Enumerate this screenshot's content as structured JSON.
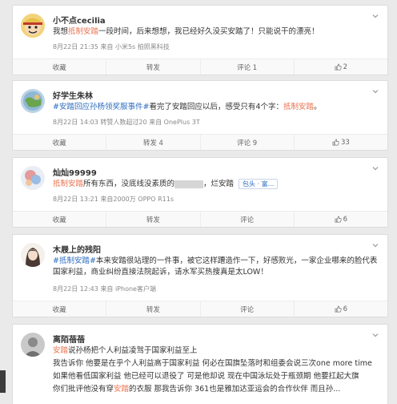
{
  "posts": [
    {
      "user": "小不点cecilia",
      "text_before": "我想",
      "tag": "抵制安踏",
      "text_after": "一段时间，后来想想，我已经好久没买安踏了！只能说干的漂亮！",
      "meta": "8月22日 21:35 来自 小米5s 拍照黑科技",
      "actions": {
        "collect": "收藏",
        "repost": "转发",
        "comment": "评论 1",
        "like": "2"
      }
    },
    {
      "user": "好学生朱林",
      "topic": "#安踏回应孙杨领奖服事件#",
      "text_mid": "看完了安踏回应以后，感受只有4个字：",
      "tag": "抵制安踏",
      "text_end": "。",
      "meta": "8月22日 14:03 转赞人数超过20 来自 OnePlus 3T",
      "actions": {
        "collect": "收藏",
        "repost": "转发 4",
        "comment": "评论 9",
        "like": "33"
      }
    },
    {
      "user": "灿灿99999",
      "tag": "抵制安踏",
      "text_after": "所有东西，没底线没素质的",
      "text_end": "，烂安踏",
      "chip": "包头 · 富...",
      "meta": "8月22日 13:21 来自2000万 OPPO R11s",
      "actions": {
        "collect": "收藏",
        "repost": "转发",
        "comment": "评论",
        "like": "6"
      }
    },
    {
      "user": "木屐上的残阳",
      "topic": "#抵制安踏#",
      "text": "本来安踏很站理的一件事，被它这样蹧造作一下，好感败光，一家企业哪来的脸代表国家利益，商业纠纷直接法院起诉，请水军买热搜真是太LOW！",
      "meta": "8月22日 12:43 来自 iPhone客户端",
      "actions": {
        "collect": "收藏",
        "repost": "转发",
        "comment": "评论",
        "like": "6"
      }
    },
    {
      "user": "离陌蓓蓓",
      "line1_tag": "安踏",
      "line1": "说孙杨把个人利益凌驾于国家利益至上",
      "line2": "我告诉你 他要是在乎个人利益高于国家利益 何必在国旗坠落时和组委会说三次one more time",
      "line3": "如果他看低国家利益 他已经可以退役了 可是他却说 现在中国泳坛处于瓶颈期 他要扛起大旗",
      "line4_pre": "你们批评他没有穿",
      "line4_tag": "安踏",
      "line4_post": "的衣服 那我告诉你 361也是雅加达亚运会的合作伙伴 而且孙..."
    }
  ]
}
